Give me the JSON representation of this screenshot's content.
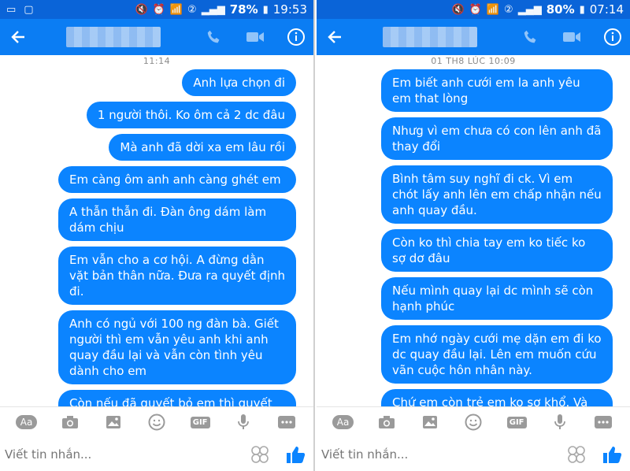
{
  "left": {
    "status": {
      "battery": "78%",
      "time": "19:53"
    },
    "date_separator": "11:14",
    "messages": [
      "Anh lựa chọn đi",
      "1 người thôi. Ko ôm cả 2 dc đâu",
      "Mà anh đã dời xa em lâu rồi",
      "Em càng ôm anh anh càng ghét em",
      "A thẫn thẫn đi. Đàn ông dám làm dám chịu",
      "Em vẫn cho a cơ hội. A đừng dằn vặt bản thân nữa. Đưa ra quyết định đi.",
      "Anh có ngủ với 100 ng đàn bà. Giết người thì em vẫn yêu anh khi anh quay đầu lại và vẫn còn tình yêu dành cho em",
      "Còn nếu đã quyết bỏ em thì quyết nhanh cho em còn có cuộc sống"
    ],
    "composer": {
      "aa": "Aa",
      "gif": "GIF",
      "placeholder": "Viết tin nhắn..."
    }
  },
  "right": {
    "status": {
      "battery": "80%",
      "time": "07:14"
    },
    "date_separator": "01 TH8 LÚC 10:09",
    "messages": [
      "Em biết anh cưới em la anh yêu em that lòng",
      "Nhưg vì em chưa có con lên anh đã thay đổi",
      "Bình tâm suy nghĩ đi ck. Vì em chót lấy anh lên em chấp nhận nếu anh quay đầu.",
      "Còn ko thì chia tay em ko tiếc ko sợ dơ đâu",
      "Nếu mình quay lại dc mình sẽ còn hạnh phúc",
      "Em nhớ ngày cưới mẹ dặn em đi ko dc quay đầu lại. Lên em muốn cứu vãn cuộc hôn nhân này.",
      "Chứ em còn trẻ em ko sợ khổ. Và em sẽ ko bao giờ khổ"
    ],
    "composer": {
      "aa": "Aa",
      "gif": "GIF",
      "placeholder": "Viết tin nhắn..."
    }
  },
  "colors": {
    "header": "#0b7df3",
    "statusbar": "#0a64d8",
    "bubble": "#0b84ff"
  },
  "icons": [
    "back-arrow-icon",
    "phone-icon",
    "video-icon",
    "info-icon",
    "camera-icon",
    "image-icon",
    "smiley-icon",
    "mic-icon",
    "more-icon",
    "emoji-icon",
    "thumbs-up-icon"
  ]
}
